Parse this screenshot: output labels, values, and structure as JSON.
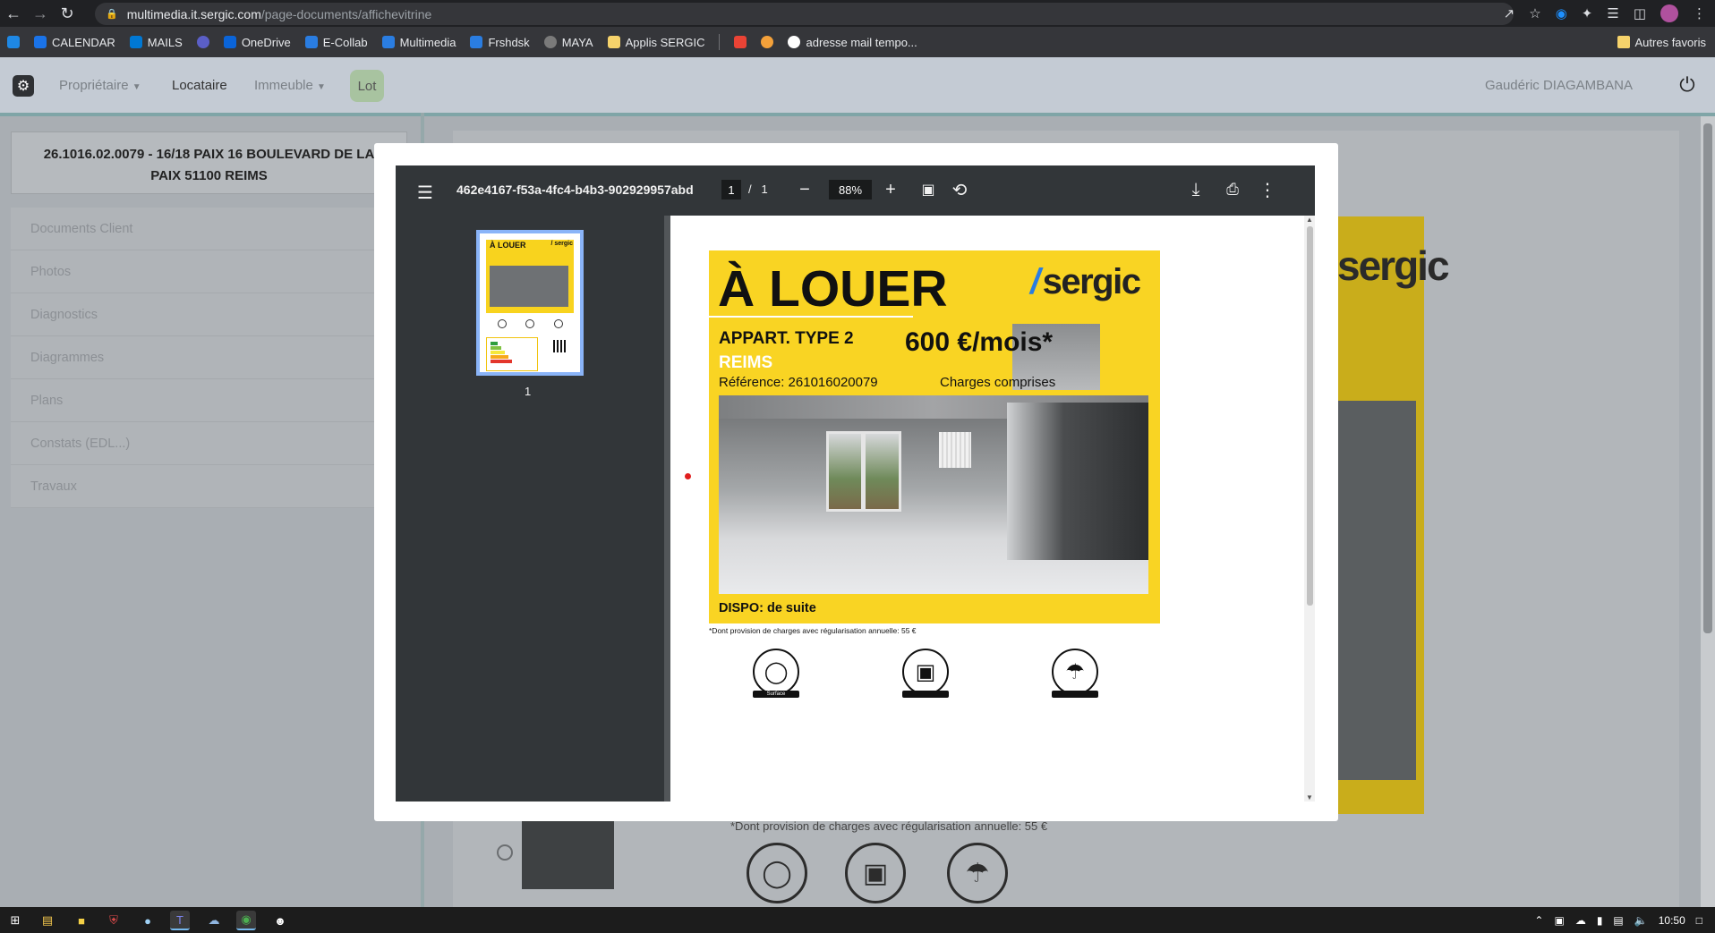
{
  "browser": {
    "url_host": "multimedia.it.sergic.com",
    "url_path": "/page-documents/affichevitrine",
    "bookmarks": [
      {
        "label": "CALENDAR",
        "icon": "calendar-icon",
        "color": "#1a73e8"
      },
      {
        "label": "MAILS",
        "icon": "outlook-icon",
        "color": "#0078d4"
      },
      {
        "label": "",
        "icon": "globe-icon",
        "color": "#5b5fc7"
      },
      {
        "label": "OneDrive",
        "icon": "onedrive-icon",
        "color": "#0a64d8"
      },
      {
        "label": "E-Collab",
        "icon": "sergic-icon",
        "color": "#2a7de1"
      },
      {
        "label": "Multimedia",
        "icon": "sergic-icon",
        "color": "#2a7de1"
      },
      {
        "label": "Frshdsk",
        "icon": "sergic-icon",
        "color": "#2a7de1"
      },
      {
        "label": "MAYA",
        "icon": "globe-icon",
        "color": "#7a7a7a"
      },
      {
        "label": "Applis SERGIC",
        "icon": "folder-icon",
        "color": "#f6d36b"
      }
    ],
    "bookmarks_extra": [
      {
        "label": "",
        "icon": "gmail-icon",
        "color": "#ea4335"
      },
      {
        "label": "",
        "icon": "emoji-icon",
        "color": "#f4a13a"
      },
      {
        "label": "adresse mail tempo...",
        "icon": "google-icon",
        "color": "#ffffff"
      }
    ],
    "other_bookmarks": "Autres favoris"
  },
  "appnav": {
    "items": [
      "Propriétaire",
      "Locataire",
      "Immeuble",
      "Lot"
    ],
    "user": "Gaudéric DIAGAMBANA"
  },
  "left_panel": {
    "card_line1": "26.1016.02.0079 - 16/18 PAIX 16 BOULEVARD DE LA",
    "card_line2": "PAIX 51100 REIMS",
    "menu": [
      "Documents Client",
      "Photos",
      "Diagnostics",
      "Diagrammes",
      "Plans",
      "Constats (EDL...)",
      "Travaux"
    ]
  },
  "background": {
    "logo_text": "sergic",
    "bottom_note": "*Dont provision de charges avec régularisation annuelle: 55 €"
  },
  "pdf": {
    "filename": "462e4167-f53a-4fc4-b4b3-902929957abd",
    "page_current": "1",
    "page_sep": "/",
    "page_total": "1",
    "zoom": "88%",
    "thumb_number": "1"
  },
  "flyer": {
    "title": "À LOUER",
    "logo": "sergic",
    "type": "APPART. TYPE 2",
    "city": "REIMS",
    "reference": "Référence: 261016020079",
    "price": "600 €/mois*",
    "charges": "Charges comprises",
    "dispo": "DISPO: de suite",
    "note": "*Dont provision de charges avec régularisation annuelle: 55 €",
    "surface_label": "Surface",
    "thumb_title": "À LOUER",
    "thumb_logo": "/ sergic"
  },
  "taskbar": {
    "time": "10:50"
  }
}
